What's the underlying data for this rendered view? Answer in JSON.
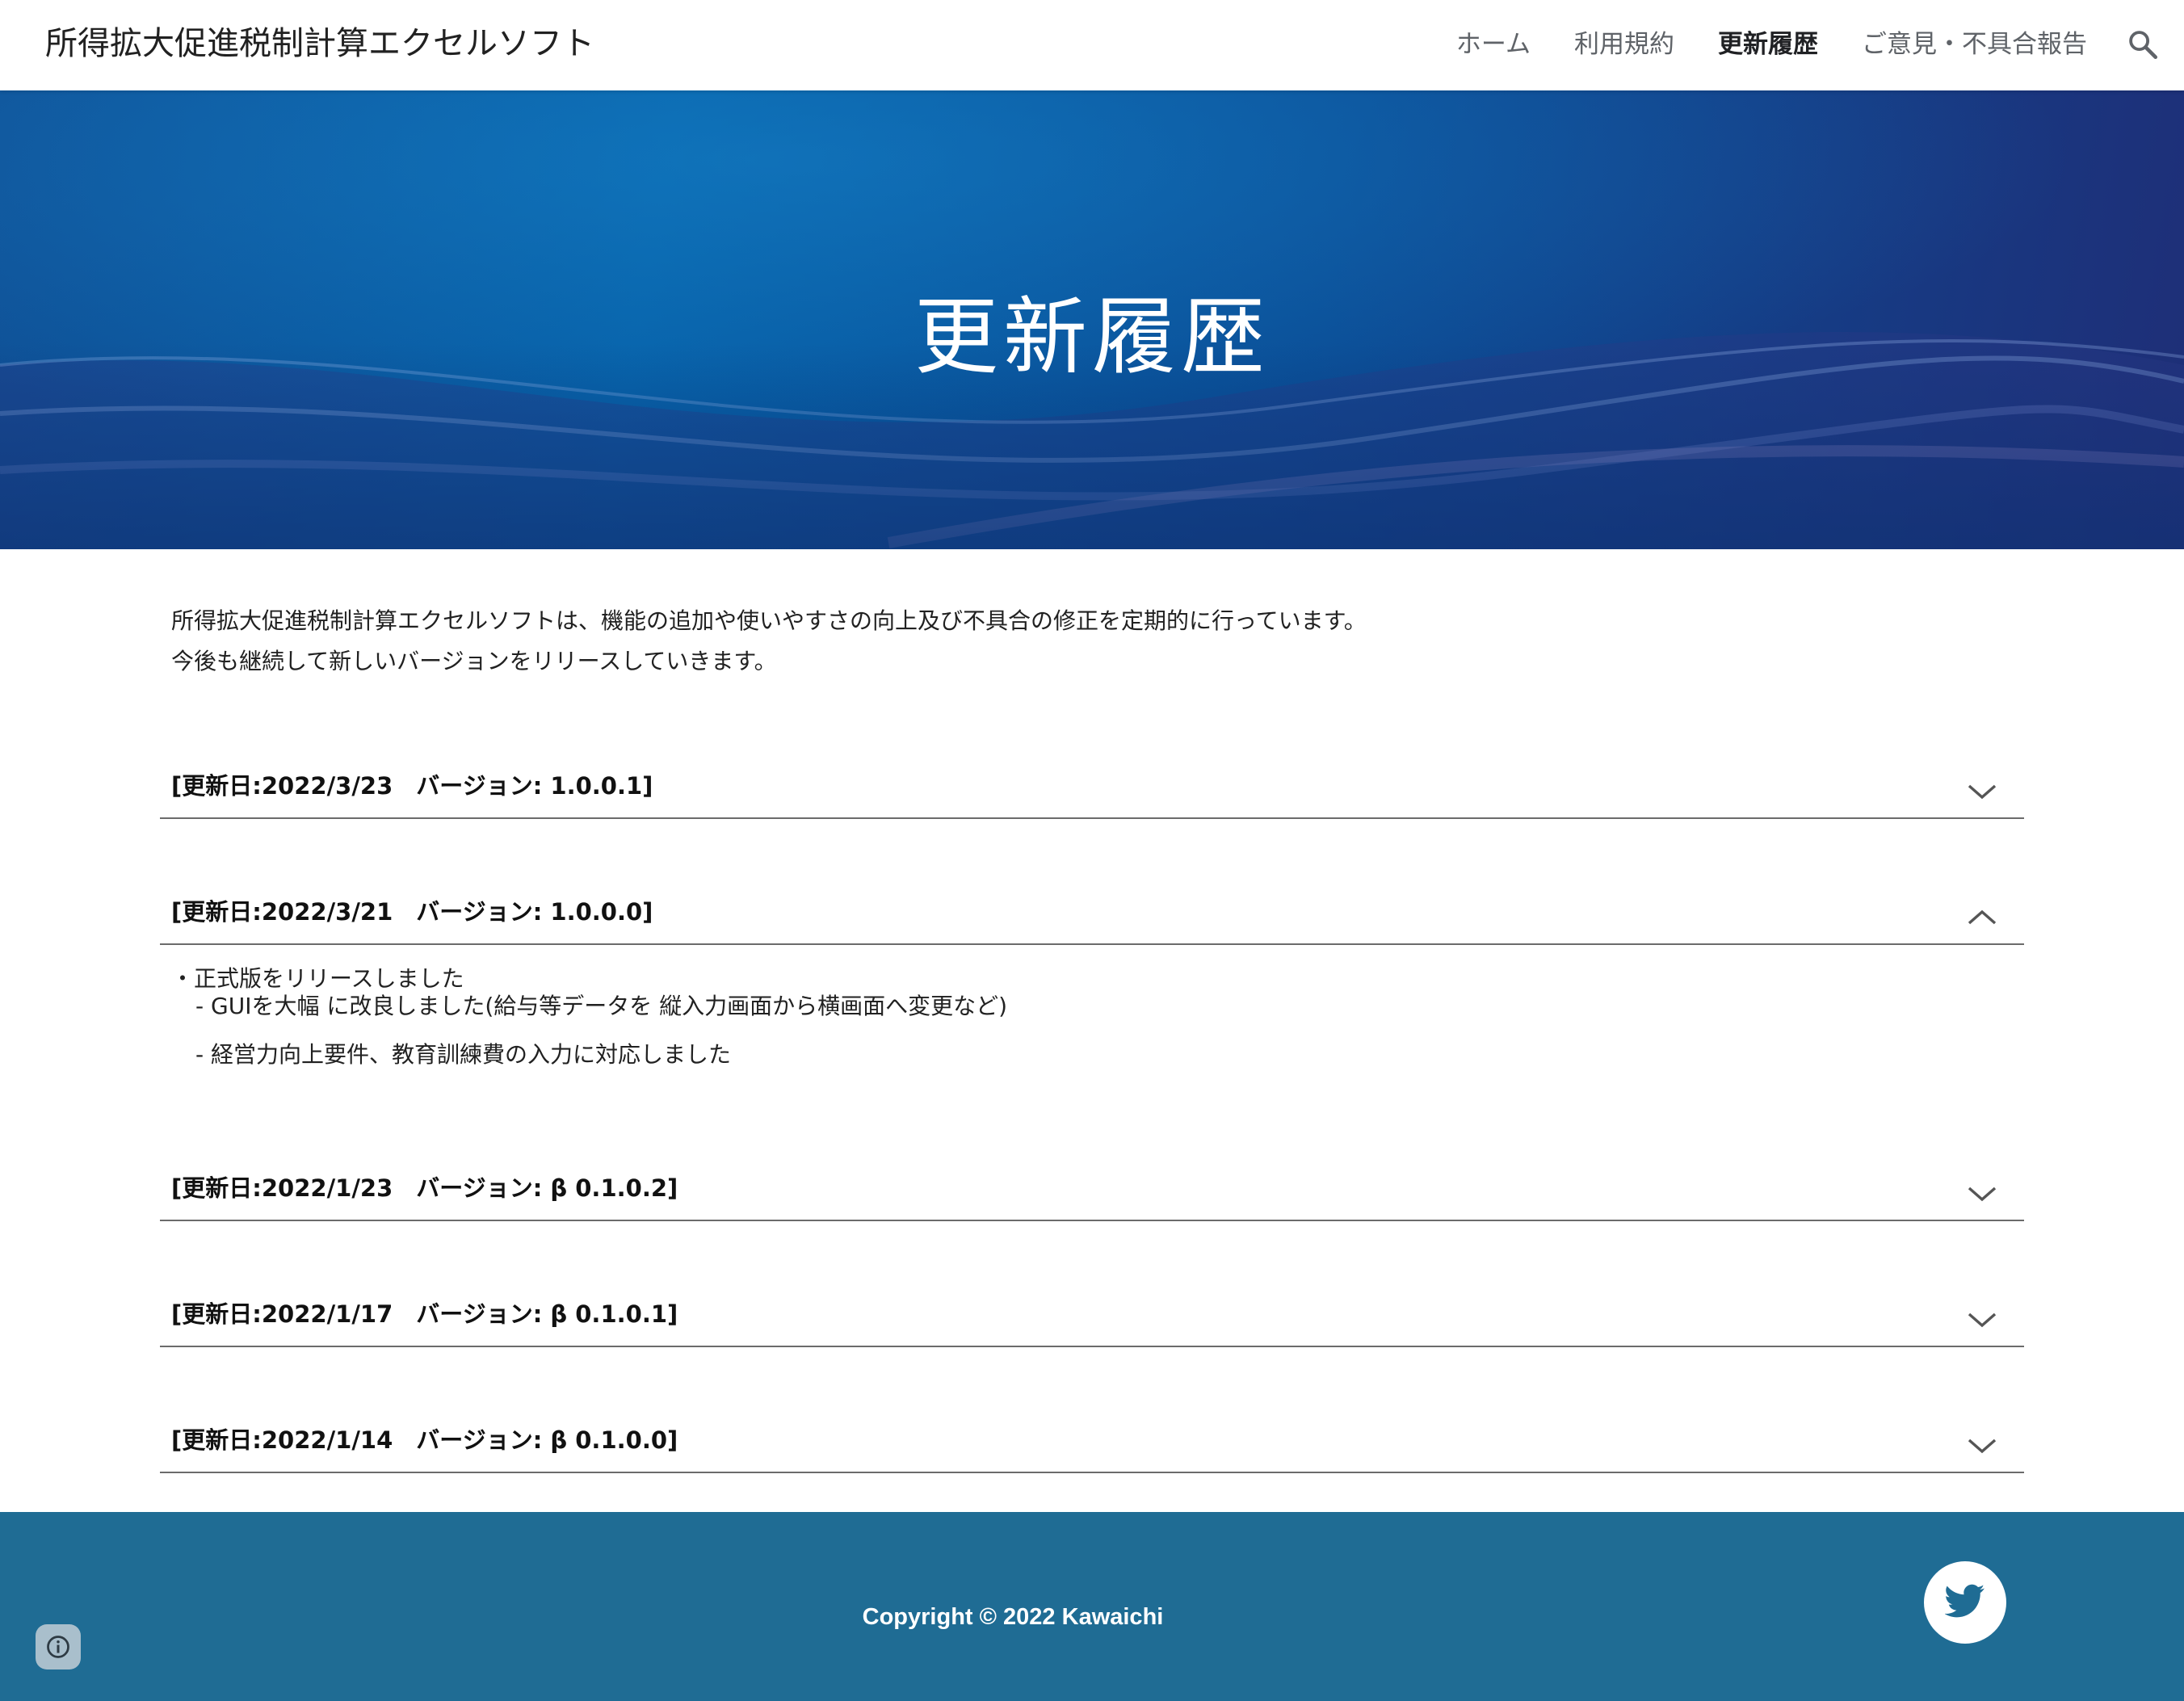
{
  "site": {
    "title": "所得拡大促進税制計算エクセルソフト"
  },
  "nav": {
    "items": [
      {
        "label": "ホーム",
        "active": false
      },
      {
        "label": "利用規約",
        "active": false
      },
      {
        "label": "更新履歴",
        "active": true
      },
      {
        "label": "ご意見・不具合報告",
        "active": false
      }
    ],
    "search_icon": "search-icon"
  },
  "hero": {
    "title": "更新履歴"
  },
  "intro": {
    "line1": "所得拡大促進税制計算エクセルソフトは、機能の追加や使いやすさの向上及び不具合の修正を定期的に行っています。",
    "line2": "今後も継続して新しいバージョンをリリースしていきます。"
  },
  "history": [
    {
      "title": "[更新日:2022/3/23　バージョン: 1.0.0.1]",
      "expanded": false
    },
    {
      "title": "[更新日:2022/3/21　バージョン: 1.0.0.0]",
      "expanded": true,
      "body": {
        "bullet": "・正式版をリリースしました",
        "sub1": "- GUIを大幅 に改良しました(給与等データを 縦入力画面から横画面へ変更など)",
        "sub2": "- 経営力向上要件、教育訓練費の入力に対応しました"
      }
    },
    {
      "title": "[更新日:2022/1/23　バージョン: β 0.1.0.2]",
      "expanded": false
    },
    {
      "title": "[更新日:2022/1/17　バージョン: β 0.1.0.1]",
      "expanded": false
    },
    {
      "title": "[更新日:2022/1/14　バージョン: β 0.1.0.0]",
      "expanded": false
    }
  ],
  "footer": {
    "copyright": "Copyright © 2022 Kawaichi",
    "background": "#1f6c94",
    "twitter_icon": "twitter-bird-icon",
    "info_icon": "info-icon"
  },
  "colors": {
    "hero_start": "#0660a8",
    "hero_end": "#1f2e77",
    "divider": "#6b6b6b"
  }
}
